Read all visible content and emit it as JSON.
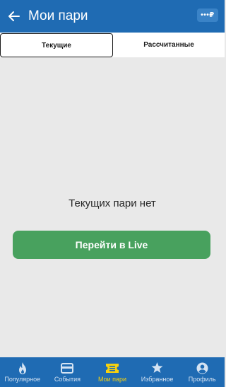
{
  "header": {
    "title": "Мои пари",
    "balance_label": "•••₽"
  },
  "tabs": [
    {
      "label": "Текущие",
      "active": true
    },
    {
      "label": "Рассчитанные",
      "active": false
    }
  ],
  "empty_state": {
    "message": "Текущих пари нет",
    "button_label": "Перейти в Live"
  },
  "bottom_nav": [
    {
      "label": "Популярное",
      "icon": "flame-icon",
      "active": false
    },
    {
      "label": "События",
      "icon": "card-icon",
      "active": false
    },
    {
      "label": "Мои пари",
      "icon": "ticket-icon",
      "active": true
    },
    {
      "label": "Избранное",
      "icon": "star-icon",
      "active": false
    },
    {
      "label": "Профиль",
      "icon": "profile-icon",
      "active": false
    }
  ],
  "colors": {
    "primary": "#1f6bb3",
    "accent_green": "#48a15e",
    "active_nav": "#f5d10f",
    "background": "#e9e9e9"
  }
}
